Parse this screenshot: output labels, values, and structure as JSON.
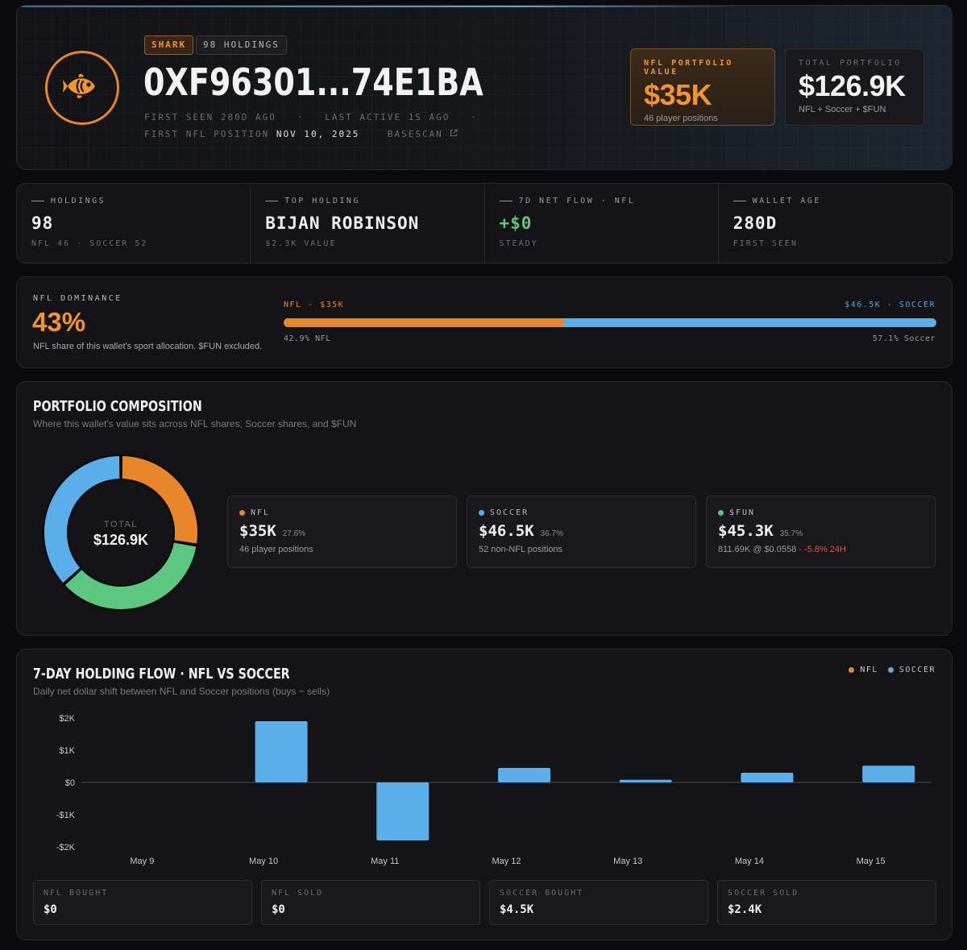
{
  "header": {
    "tier_badge": "SHARK",
    "holdings_badge": "98 HOLDINGS",
    "address": "0XF96301...74E1BA",
    "first_seen": "FIRST SEEN 280D AGO",
    "last_active": "LAST ACTIVE 1S AGO",
    "first_nfl_label": "FIRST NFL POSITION",
    "first_nfl_date": "NOV 10, 2025",
    "basescan": "BASESCAN",
    "icons": {
      "avatar": "fish-icon",
      "external": "external-link-icon"
    },
    "nfl_value": {
      "label": "NFL PORTFOLIO VALUE",
      "value": "$35K",
      "sub": "46 player positions"
    },
    "total_value": {
      "label": "TOTAL PORTFOLIO",
      "value": "$126.9K",
      "sub": "NFL + Soccer + $FUN"
    }
  },
  "stats": [
    {
      "label": "HOLDINGS",
      "value": "98",
      "sub": "NFL 46 · SOCCER 52"
    },
    {
      "label": "TOP HOLDING",
      "value": "BIJAN ROBINSON",
      "sub": "$2.3K VALUE"
    },
    {
      "label": "7D NET FLOW · NFL",
      "value": "+$0",
      "sub": "STEADY"
    },
    {
      "label": "WALLET AGE",
      "value": "280D",
      "sub": "FIRST SEEN"
    }
  ],
  "dominance": {
    "label": "NFL DOMINANCE",
    "value": "43%",
    "desc": "NFL share of this wallet's sport allocation. $FUN excluded.",
    "bar_left_label": "NFL · $35K",
    "bar_right_label": "$46.5K · SOCCER",
    "nfl_share": 42.9,
    "left_pct": "42.9% NFL",
    "right_pct": "57.1% Soccer"
  },
  "composition": {
    "title": "PORTFOLIO COMPOSITION",
    "subtitle": "Where this wallet's value sits across NFL shares, Soccer shares, and $FUN",
    "donut_label": "TOTAL",
    "donut_value": "$126.9K",
    "slices": [
      {
        "name": "NFL",
        "share": 27.6,
        "color": "#e8862a"
      },
      {
        "name": "$FUN",
        "share": 35.7,
        "color": "#5cc77e"
      },
      {
        "name": "SOCCER",
        "share": 36.7,
        "color": "#5aaeea"
      }
    ],
    "cards": [
      {
        "label": "NFL",
        "value": "$35K",
        "pct": "27.6%",
        "sub": "46 player positions",
        "sub_neg": "",
        "color": "#e8862a"
      },
      {
        "label": "SOCCER",
        "value": "$46.5K",
        "pct": "36.7%",
        "sub": "52 non-NFL positions",
        "sub_neg": "",
        "color": "#5aaeea"
      },
      {
        "label": "$FUN",
        "value": "$45.3K",
        "pct": "35.7%",
        "sub": "811.69K @ $0.0558 ·",
        "sub_neg": "-5.8% 24H",
        "color": "#5cc77e"
      }
    ]
  },
  "flow": {
    "title": "7-DAY HOLDING FLOW · NFL VS SOCCER",
    "subtitle": "Daily net dollar shift between NFL and Soccer positions (buys − sells)",
    "legend": [
      {
        "name": "NFL",
        "color": "#e8862a"
      },
      {
        "name": "SOCCER",
        "color": "#5aaeea"
      }
    ],
    "totals": [
      {
        "label": "NFL BOUGHT",
        "value": "$0"
      },
      {
        "label": "NFL SOLD",
        "value": "$0"
      },
      {
        "label": "SOCCER BOUGHT",
        "value": "$4.5K"
      },
      {
        "label": "SOCCER SOLD",
        "value": "$2.4K"
      }
    ]
  },
  "chart_data": {
    "type": "bar",
    "categories": [
      "May 9",
      "May 10",
      "May 11",
      "May 12",
      "May 13",
      "May 14",
      "May 15"
    ],
    "series": [
      {
        "name": "NFL",
        "values": [
          0,
          0,
          0,
          0,
          0,
          0,
          0
        ],
        "color": "#e8862a"
      },
      {
        "name": "SOCCER",
        "values": [
          0,
          1900,
          -1800,
          450,
          80,
          300,
          520
        ],
        "color": "#5aaeea"
      }
    ],
    "yticks": [
      "$2K",
      "$1K",
      "$0",
      "-$1K",
      "-$2K"
    ],
    "ylim": [
      -2000,
      2000
    ],
    "grid": false,
    "legend_position": "top-right"
  }
}
